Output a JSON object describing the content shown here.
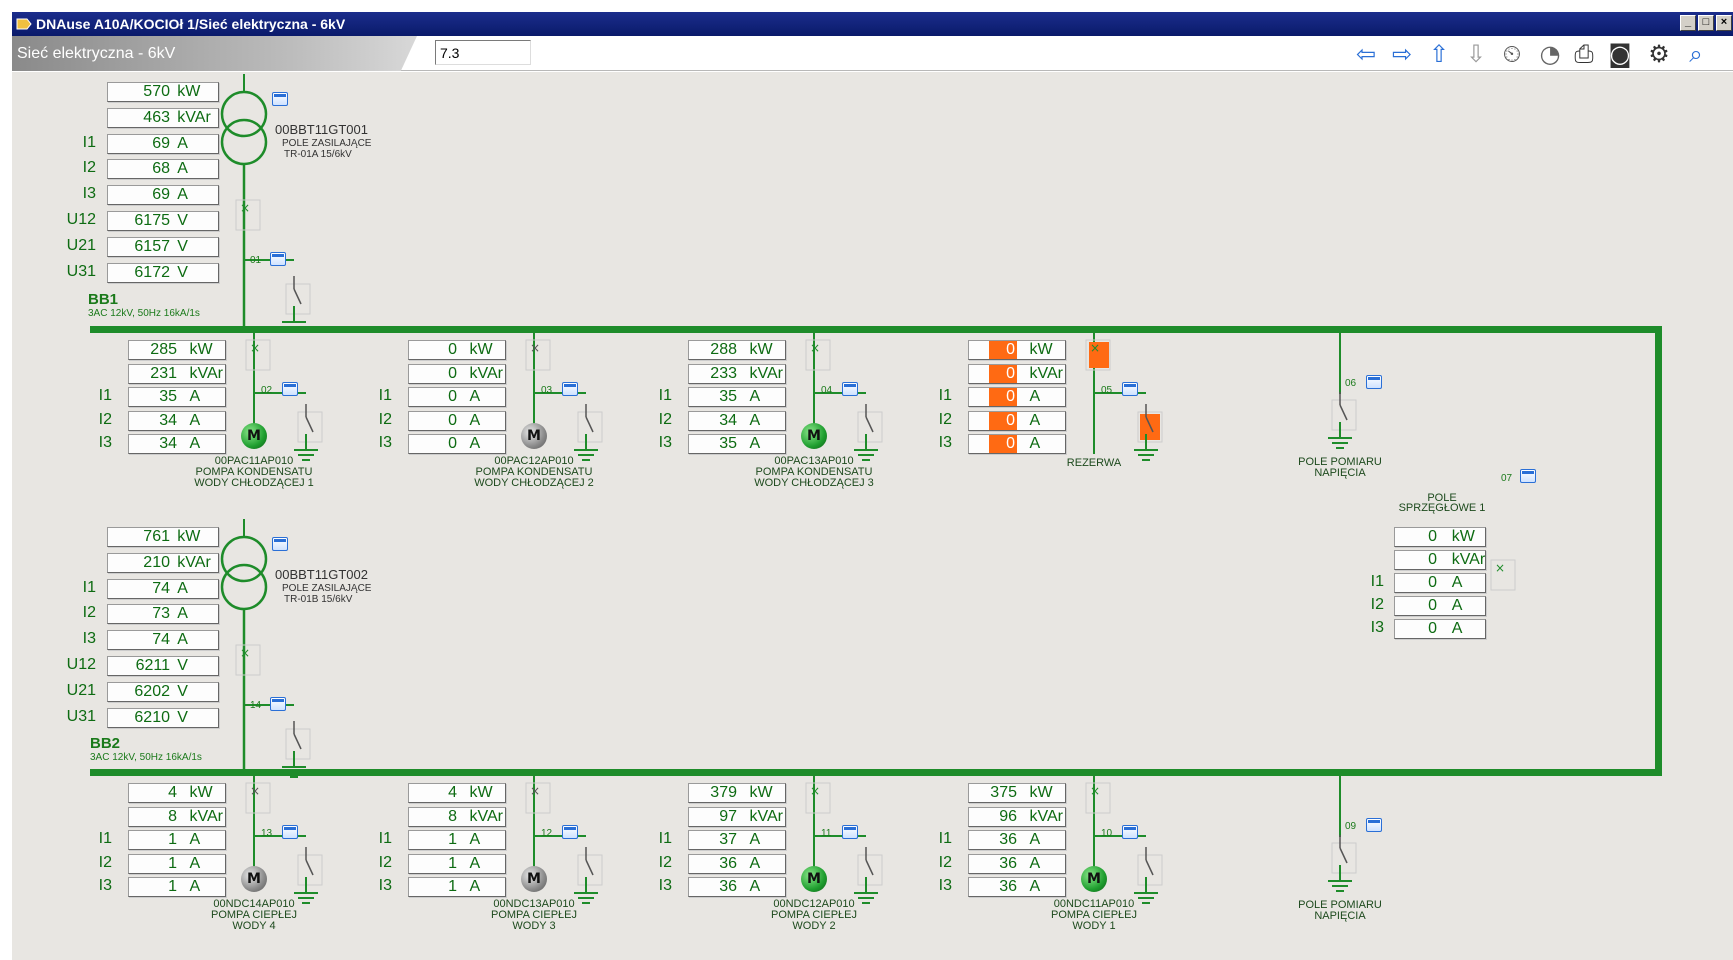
{
  "window": {
    "title": "DNAuse A10A/KOCIOł 1/Sieć elektryczna - 6kV"
  },
  "toolbar": {
    "label": "Sieć elektryczna - 6kV",
    "input_value": "7.3",
    "buttons": [
      "back-arrow-icon",
      "forward-arrow-icon",
      "up-arrow-icon",
      "down-arrow-icon",
      "history-clock-icon",
      "gauge-icon",
      "print-icon",
      "camera-icon",
      "settings-icon",
      "zoom-icon"
    ]
  },
  "colors": {
    "bus": "#1e8c2a",
    "alarm": "#ff6a13",
    "value": "#0d6b12"
  },
  "busbars": [
    {
      "name": "BB1",
      "desc": "3AC 12kV, 50Hz 16kA/1s"
    },
    {
      "name": "BB2",
      "desc": "3AC 12kV, 50Hz 16kA/1s"
    }
  ],
  "transformers": [
    {
      "id": "00BBT11GT001",
      "desc1": "POLE ZASILAJĄCE",
      "desc2": "TR-01A 15/6kV",
      "field": "01",
      "rows": [
        {
          "lbl": "",
          "v": "570",
          "u": "kW"
        },
        {
          "lbl": "",
          "v": "463",
          "u": "kVAr"
        },
        {
          "lbl": "I1",
          "v": "69",
          "u": "A"
        },
        {
          "lbl": "I2",
          "v": "68",
          "u": "A"
        },
        {
          "lbl": "I3",
          "v": "69",
          "u": "A"
        },
        {
          "lbl": "U12",
          "v": "6175",
          "u": "V"
        },
        {
          "lbl": "U21",
          "v": "6157",
          "u": "V"
        },
        {
          "lbl": "U31",
          "v": "6172",
          "u": "V"
        }
      ]
    },
    {
      "id": "00BBT11GT002",
      "desc1": "POLE ZASILAJĄCE",
      "desc2": "TR-01B 15/6kV",
      "field": "14",
      "rows": [
        {
          "lbl": "",
          "v": "761",
          "u": "kW"
        },
        {
          "lbl": "",
          "v": "210",
          "u": "kVAr"
        },
        {
          "lbl": "I1",
          "v": "74",
          "u": "A"
        },
        {
          "lbl": "I2",
          "v": "73",
          "u": "A"
        },
        {
          "lbl": "I3",
          "v": "74",
          "u": "A"
        },
        {
          "lbl": "U12",
          "v": "6211",
          "u": "V"
        },
        {
          "lbl": "U21",
          "v": "6202",
          "u": "V"
        },
        {
          "lbl": "U31",
          "v": "6210",
          "u": "V"
        }
      ]
    }
  ],
  "feeders_top": [
    {
      "field": "02",
      "motor": "on",
      "l1": "00PAC11AP010",
      "l2": "POMPA KONDENSATU",
      "l3": "WODY CHŁODZĄCEJ 1",
      "kw": "285",
      "kvar": "231",
      "i1": "35",
      "i2": "34",
      "i3": "34"
    },
    {
      "field": "03",
      "motor": "off",
      "l1": "00PAC12AP010",
      "l2": "POMPA KONDENSATU",
      "l3": "WODY CHŁODZĄCEJ 2",
      "kw": "0",
      "kvar": "0",
      "i1": "0",
      "i2": "0",
      "i3": "0"
    },
    {
      "field": "04",
      "motor": "on",
      "l1": "00PAC13AP010",
      "l2": "POMPA KONDENSATU",
      "l3": "WODY CHŁODZĄCEJ 3",
      "kw": "288",
      "kvar": "233",
      "i1": "35",
      "i2": "34",
      "i3": "35"
    },
    {
      "field": "05",
      "motor": "none",
      "l1": "REZERWA",
      "l2": "",
      "l3": "",
      "kw": "0",
      "kvar": "0",
      "i1": "0",
      "i2": "0",
      "i3": "0",
      "alarm": true
    }
  ],
  "feeders_bottom": [
    {
      "field": "13",
      "motor": "off",
      "l1": "00NDC14AP010",
      "l2": "POMPA CIEPŁEJ",
      "l3": "WODY 4",
      "kw": "4",
      "kvar": "8",
      "i1": "1",
      "i2": "1",
      "i3": "1"
    },
    {
      "field": "12",
      "motor": "off",
      "l1": "00NDC13AP010",
      "l2": "POMPA CIEPŁEJ",
      "l3": "WODY 3",
      "kw": "4",
      "kvar": "8",
      "i1": "1",
      "i2": "1",
      "i3": "1"
    },
    {
      "field": "11",
      "motor": "on",
      "l1": "00NDC12AP010",
      "l2": "POMPA CIEPŁEJ",
      "l3": "WODY 2",
      "kw": "379",
      "kvar": "97",
      "i1": "37",
      "i2": "36",
      "i3": "36"
    },
    {
      "field": "10",
      "motor": "on",
      "l1": "00NDC11AP010",
      "l2": "POMPA CIEPŁEJ",
      "l3": "WODY 1",
      "kw": "375",
      "kvar": "96",
      "i1": "36",
      "i2": "36",
      "i3": "36"
    }
  ],
  "measure_fields": [
    {
      "field": "06",
      "l1": "POLE POMIARU",
      "l2": "NAPIĘCIA"
    },
    {
      "field": "09",
      "l1": "POLE POMIARU",
      "l2": "NAPIĘCIA"
    }
  ],
  "coupler": {
    "field": "07",
    "l1": "POLE",
    "l2": "SPRZĘGŁOWE 1",
    "rows": [
      {
        "lbl": "",
        "v": "0",
        "u": "kW"
      },
      {
        "lbl": "",
        "v": "0",
        "u": "kVAr"
      },
      {
        "lbl": "I1",
        "v": "0",
        "u": "A"
      },
      {
        "lbl": "I2",
        "v": "0",
        "u": "A"
      },
      {
        "lbl": "I3",
        "v": "0",
        "u": "A"
      }
    ]
  }
}
